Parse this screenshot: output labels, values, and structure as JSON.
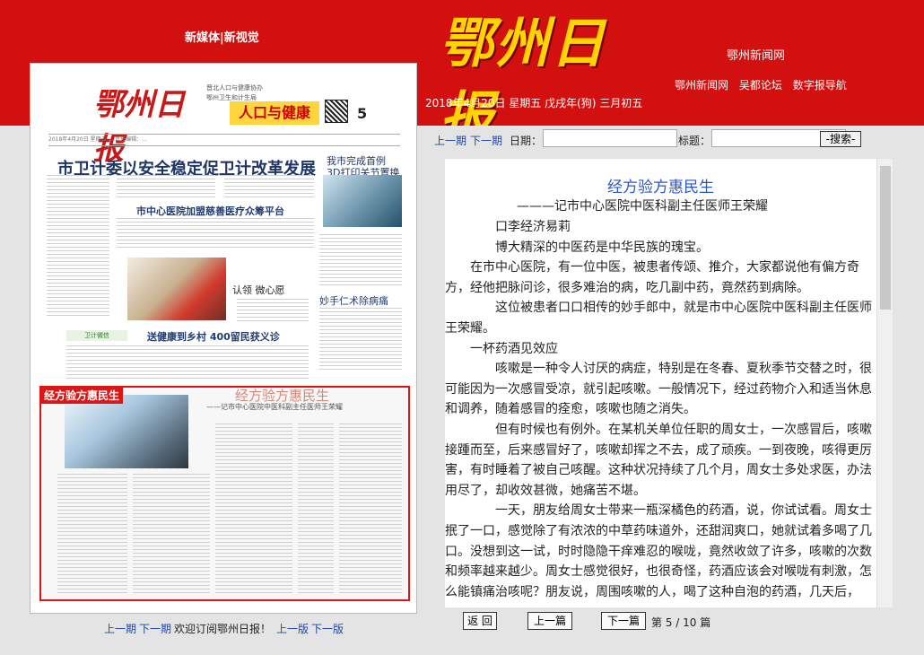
{
  "header": {
    "mini_links": "新媒体|新视觉",
    "logo_text": "鄂州日报",
    "date": "2018年4月20日 星期五 戊戌年(狗) 三月初五",
    "site_name": "鄂州新闻网",
    "links": [
      "鄂州新闻网",
      "吴都论坛",
      "数字报导航"
    ]
  },
  "left_page": {
    "masthead": "鄂州日报",
    "mast_note1": "晋北人口与健康协办",
    "mast_note2": "鄂州卫生和计生局",
    "section_name": "人口与健康",
    "page_number": "5",
    "strip": "2018年4月20日   星期五   ...   责任编辑：...",
    "headline": "市卫计委以安全稳定促卫计改革发展",
    "side_headline": "我市完成首例\n3D打印关节置换术",
    "headline2": "市中心医院加盟慈善医疗众筹平台",
    "headline3": "认领 微心愿",
    "headline4": "妙手仁术除病痛",
    "headline5": "送健康到乡村  400留民获义诊",
    "wechat_label": "卫计微信",
    "highlight_label": "经方验方惠民生",
    "highlight_title": "经方验方惠民生",
    "highlight_sub": "——记市中心医院中医科副主任医师王荣耀"
  },
  "left_nav": {
    "prev_issue": "上一期",
    "next_issue": "下一期",
    "welcome": "欢迎订阅鄂州日报！",
    "prev_page": "上一版",
    "next_page": "下一版"
  },
  "toolbar": {
    "prev_issue": "上一期",
    "next_issue": "下一期",
    "date_label": "日期：",
    "title_label": "标题：",
    "search_button": "-搜索-"
  },
  "article": {
    "title": "经方验方惠民生",
    "subtitle": "———记市中心医院中医科副主任医师王荣耀",
    "paragraphs": [
      "口李经济易莉",
      "博大精深的中医药是中华民族的瑰宝。",
      "在市中心医院，有一位中医，被患者传颂、推介，大家都说他有偏方奇方，经他把脉问诊，很多难治的病，吃几副中药，竟然药到病除。",
      "这位被患者口口相传的妙手郎中，就是市中心医院中医科副主任医师王荣耀。",
      "一杯药酒见效应",
      "咳嗽是一种令人讨厌的病症，特别是在冬春、夏秋季节交替之时，很可能因为一次感冒受凉，就引起咳嗽。一般情况下，经过药物介入和适当休息和调养，随着感冒的痊愈，咳嗽也随之消失。",
      "但有时候也有例外。在某机关单位任职的周女士，一次感冒后，咳嗽接踵而至，后来感冒好了，咳嗽却挥之不去，成了顽疾。一到夜晚，咳得更厉害，有时睡着了被自己咳醒。这种状况持续了几个月，周女士多处求医，办法用尽了，却收效甚微，她痛苦不堪。",
      "一天，朋友给周女士带来一瓶深橘色的药酒，说，你试试看。周女士抿了一口，感觉除了有浓浓的中草药味道外，还甜润爽口，她就试着多喝了几口。没想到这一试，时时隐隐干痒难忍的喉咙，竟然收敛了许多，咳嗽的次数和频率越来越少。周女士感觉很好，也很奇怪，药酒应该会对喉咙有刺激，怎么能镇痛治咳呢？朋友说，周围咳嗽的人，喝了这种自泡的药酒，几天后，"
    ]
  },
  "bottom_bar": {
    "back": "返 回",
    "prev": "上一篇",
    "next": "下一篇",
    "page_info": "第 5 / 10 篇"
  }
}
